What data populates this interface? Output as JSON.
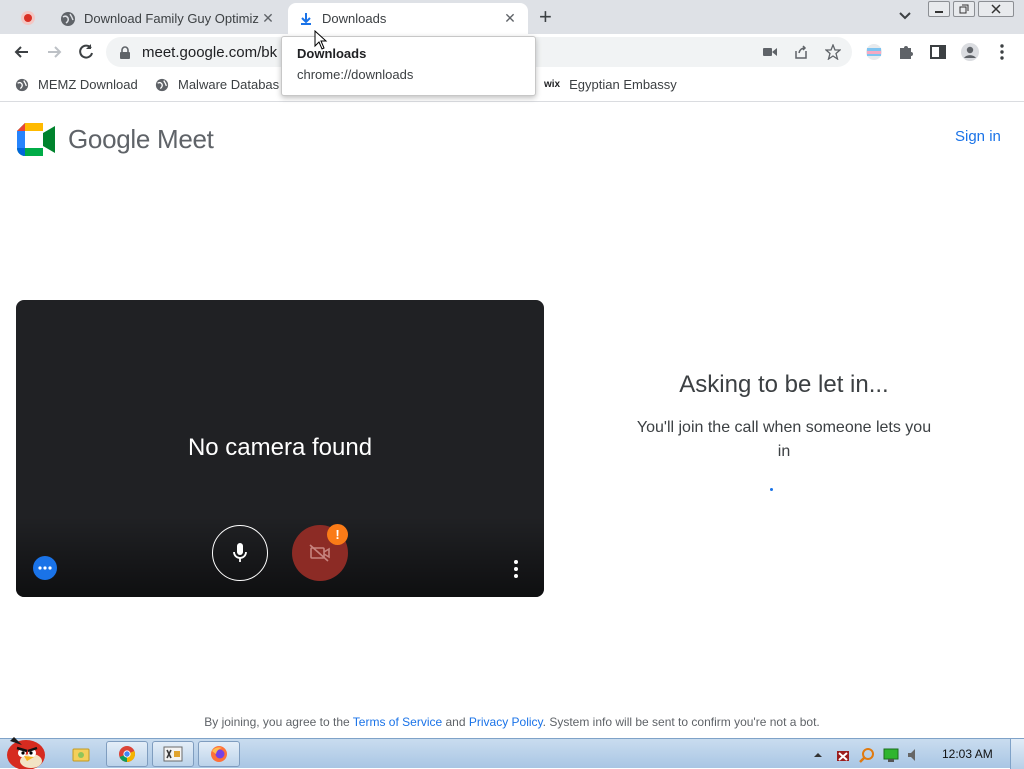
{
  "browser": {
    "tabs": [
      {
        "title": "Download Family Guy Optimiz",
        "icon": "globe-icon"
      },
      {
        "title": "Downloads",
        "icon": "download-icon"
      }
    ],
    "new_tab_glyph": "+",
    "close_glyph": "✕",
    "url": "meet.google.com/bk",
    "bookmarks": [
      {
        "label": "MEMZ Download",
        "icon": "globe-icon"
      },
      {
        "label": "Malware Databas",
        "icon": "globe-icon"
      },
      {
        "label": "Egyptian Embassy",
        "icon": "wix-icon"
      }
    ],
    "wix_glyph": "wix",
    "tooltip": {
      "title": "Downloads",
      "url": "chrome://downloads"
    }
  },
  "page": {
    "brand": "Google Meet",
    "sign_in": "Sign in",
    "video": {
      "message": "No camera found",
      "warning_glyph": "!"
    },
    "status": {
      "title": "Asking to be let in...",
      "message": "You'll join the call when someone lets you in"
    },
    "footer": {
      "prefix": "By joining, you agree to the",
      "terms": "Terms of Service",
      "and": "and",
      "privacy": "Privacy Policy",
      "suffix": ". System info will be sent to confirm you're not a bot."
    }
  },
  "taskbar": {
    "clock": "12:03 AM"
  },
  "colors": {
    "accent": "#1a73e8",
    "cam_off": "#8c2b25",
    "warning": "#fa7b17"
  }
}
